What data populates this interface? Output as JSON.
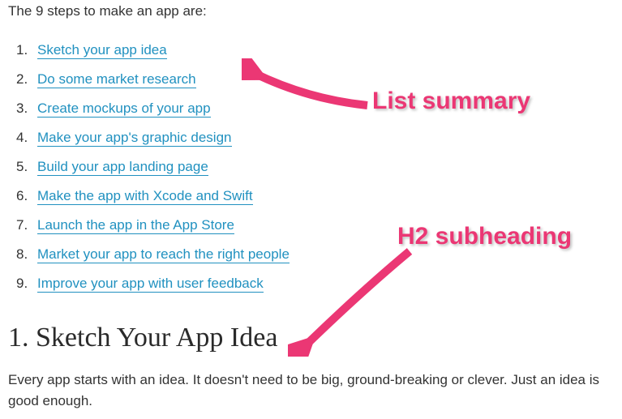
{
  "intro": "The 9 steps to make an app are:",
  "steps": [
    "Sketch your app idea",
    "Do some market research",
    "Create mockups of your app",
    "Make your app's graphic design",
    "Build your app landing page",
    "Make the app with Xcode and Swift",
    "Launch the app in the App Store",
    "Market your app to reach the right people",
    "Improve your app with user feedback"
  ],
  "heading": "1. Sketch Your App Idea",
  "body": "Every app starts with an idea. It doesn't need to be big, ground-breaking or clever. Just an idea is good enough.",
  "annotations": {
    "list_summary": "List summary",
    "h2_subheading": "H2 subheading"
  }
}
